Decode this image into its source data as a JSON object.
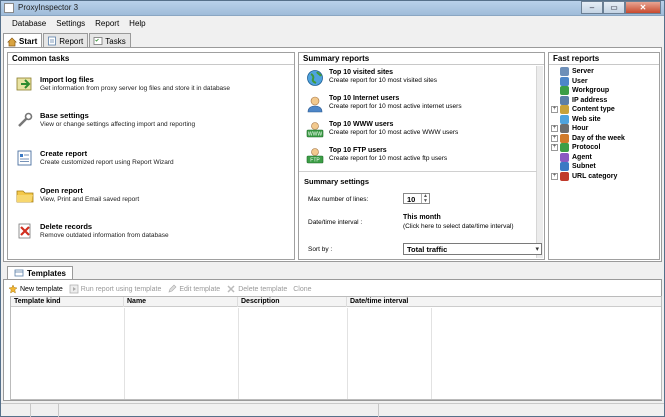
{
  "window": {
    "title": "ProxyInspector 3",
    "controls": [
      "–",
      "▭",
      "✕"
    ]
  },
  "menu": [
    "Database",
    "Settings",
    "Report",
    "Help"
  ],
  "tabs": [
    {
      "label": "Start",
      "icon": "home-icon",
      "active": true
    },
    {
      "label": "Report",
      "icon": "report-icon",
      "active": false
    },
    {
      "label": "Tasks",
      "icon": "tasks-icon",
      "active": false
    }
  ],
  "common_tasks": {
    "title": "Common tasks",
    "items": [
      {
        "title": "Import log files",
        "desc": "Get information from proxy server log files and store it in database",
        "icon": "import-arrow-icon"
      },
      {
        "title": "Base settings",
        "desc": "View or change settings affecting import and reporting",
        "icon": "wrench-icon"
      },
      {
        "title": "Create report",
        "desc": "Create customized report using Report Wizard",
        "icon": "create-report-icon"
      },
      {
        "title": "Open report",
        "desc": "View, Print and Email saved report",
        "icon": "folder-icon"
      },
      {
        "title": "Delete records",
        "desc": "Remove outdated information from database",
        "icon": "delete-records-icon"
      }
    ]
  },
  "summary_reports": {
    "title": "Summary reports",
    "items": [
      {
        "title": "Top 10 visited sites",
        "desc": "Create report for 10 most visited sites",
        "icon": "globe-icon"
      },
      {
        "title": "Top 10 Internet users",
        "desc": "Create report for 10 most active internet users",
        "icon": "user-icon"
      },
      {
        "title": "Top 10 WWW users",
        "desc": "Create report for 10 most active WWW users",
        "icon": "www-icon"
      },
      {
        "title": "Top 10 FTP users",
        "desc": "Create report for 10 most active ftp users",
        "icon": "ftp-icon"
      }
    ]
  },
  "summary_settings": {
    "title": "Summary settings",
    "max_lines_label": "Max number of lines:",
    "max_lines_value": "10",
    "interval_label": "Date/time interval :",
    "interval_value": "This month",
    "interval_hint": "(Click here to select date/time interval)",
    "sort_label": "Sort by :",
    "sort_value": "Total traffic"
  },
  "fast_reports": {
    "title": "Fast reports",
    "items": [
      {
        "label": "Server",
        "expandable": false,
        "icon": "server-icon"
      },
      {
        "label": "User",
        "expandable": false,
        "icon": "user-icon"
      },
      {
        "label": "Workgroup",
        "expandable": false,
        "icon": "workgroup-icon"
      },
      {
        "label": "IP address",
        "expandable": false,
        "icon": "ip-icon"
      },
      {
        "label": "Content type",
        "expandable": true,
        "icon": "content-type-icon"
      },
      {
        "label": "Web site",
        "expandable": false,
        "icon": "website-icon"
      },
      {
        "label": "Hour",
        "expandable": true,
        "icon": "clock-icon"
      },
      {
        "label": "Day of the week",
        "expandable": true,
        "icon": "calendar-icon"
      },
      {
        "label": "Protocol",
        "expandable": true,
        "icon": "protocol-icon"
      },
      {
        "label": "Agent",
        "expandable": false,
        "icon": "agent-icon"
      },
      {
        "label": "Subnet",
        "expandable": false,
        "icon": "subnet-icon"
      },
      {
        "label": "URL category",
        "expandable": true,
        "icon": "url-category-icon"
      }
    ]
  },
  "templates": {
    "tab_label": "Templates",
    "toolbar": [
      {
        "label": "New template",
        "enabled": true,
        "icon": "new-template-icon"
      },
      {
        "label": "Run report using template",
        "enabled": false,
        "icon": "run-icon"
      },
      {
        "label": "Edit template",
        "enabled": false,
        "icon": "edit-icon"
      },
      {
        "label": "Delete template",
        "enabled": false,
        "icon": "delete-icon"
      },
      {
        "label": "Clone",
        "enabled": false,
        "icon": ""
      }
    ],
    "columns": [
      "Template kind",
      "Name",
      "Description",
      "Date/time interval"
    ]
  }
}
